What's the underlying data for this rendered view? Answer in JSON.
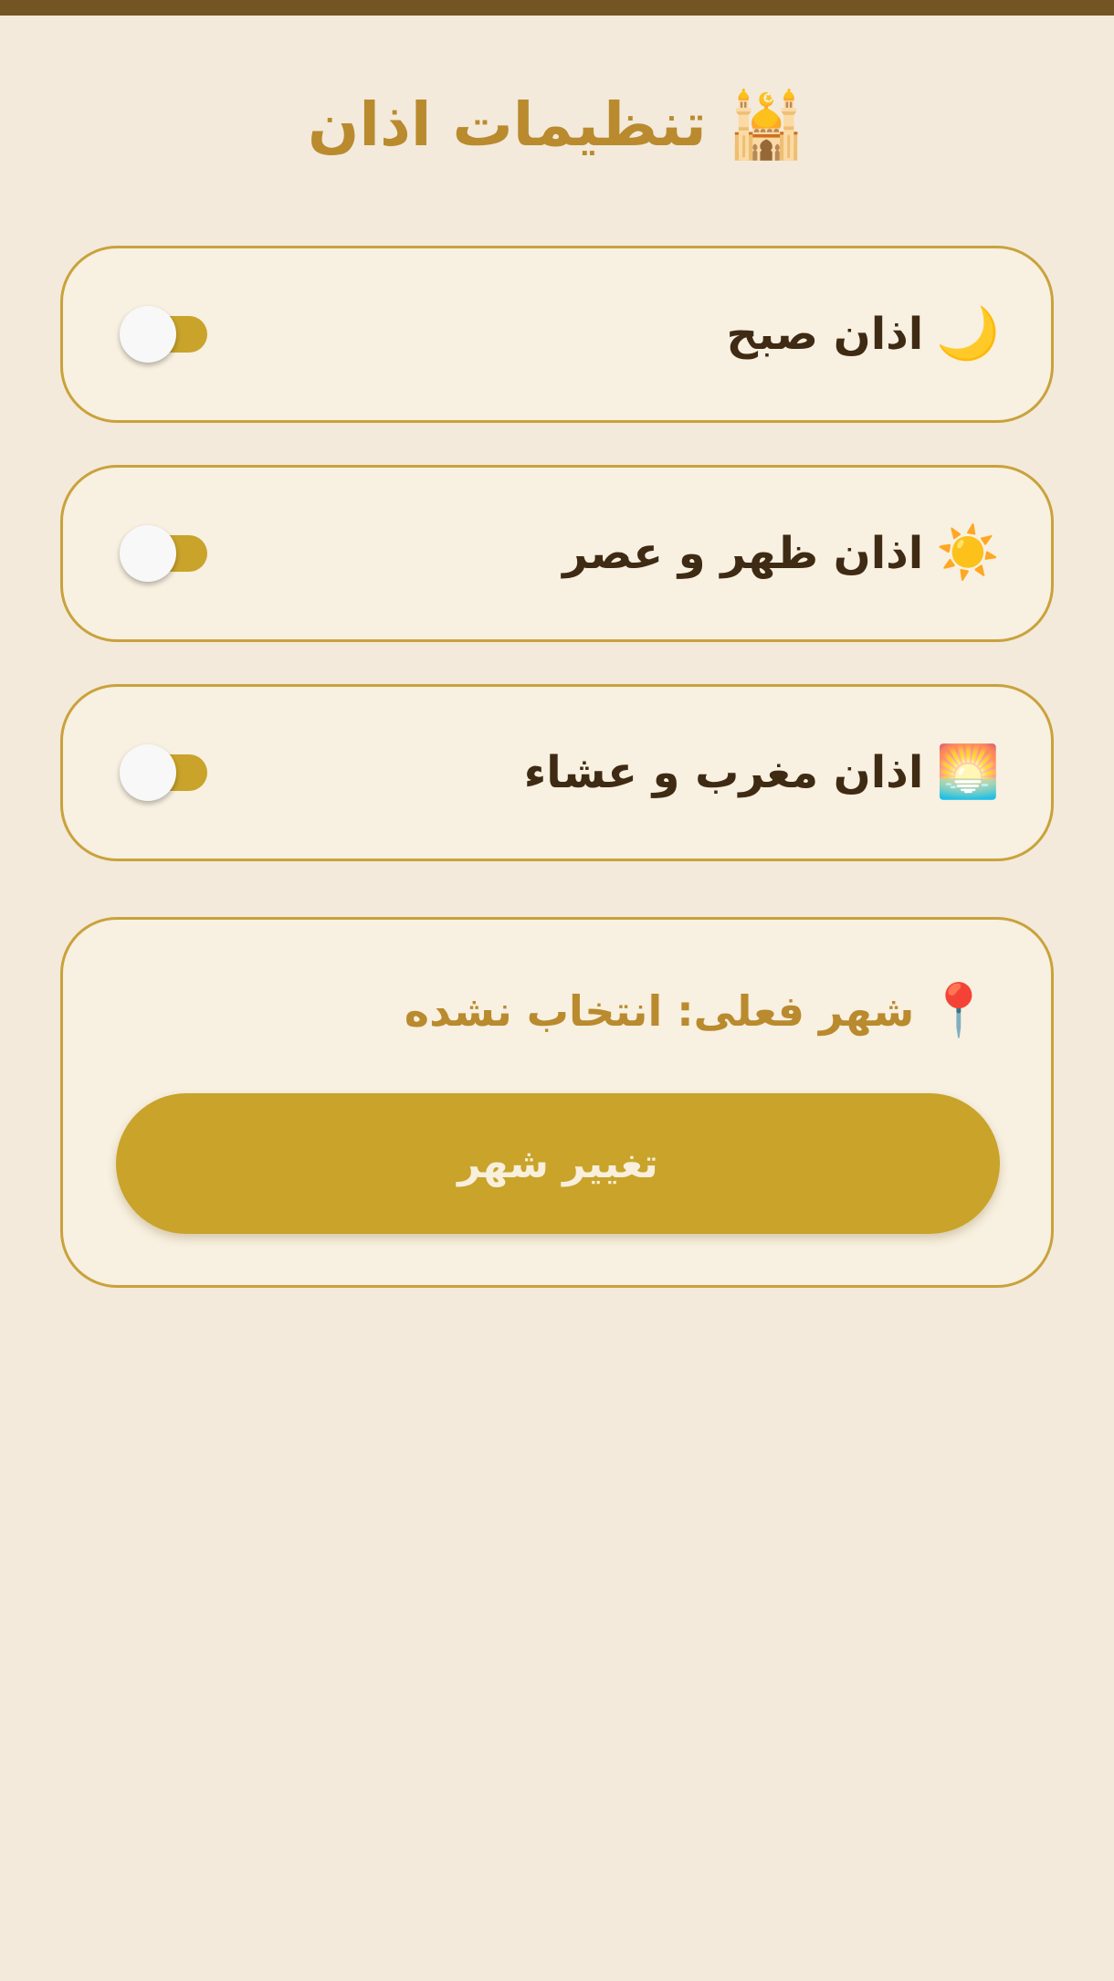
{
  "header": {
    "title": "تنظیمات اذان",
    "icon": "🕌",
    "icon_name": "mosque-icon"
  },
  "settings": [
    {
      "label": "اذان صبح",
      "icon": "🌙",
      "icon_name": "crescent-moon-icon",
      "enabled": false
    },
    {
      "label": "اذان ظهر و عصر",
      "icon": "☀️",
      "icon_name": "sun-icon",
      "enabled": false
    },
    {
      "label": "اذان مغرب و عشاء",
      "icon": "🌅",
      "icon_name": "sunset-icon",
      "enabled": false
    }
  ],
  "city": {
    "icon": "📍",
    "icon_name": "location-pin-icon",
    "current_text": "شهر فعلی: انتخاب نشده",
    "change_button_label": "تغییر شهر"
  },
  "colors": {
    "background": "#f3eadb",
    "top_bar": "#735523",
    "card_background": "#f8f0e0",
    "card_border": "#c9a23c",
    "accent": "#c9a32a",
    "title_text": "#b98a2e",
    "label_text": "#3f2a14"
  }
}
